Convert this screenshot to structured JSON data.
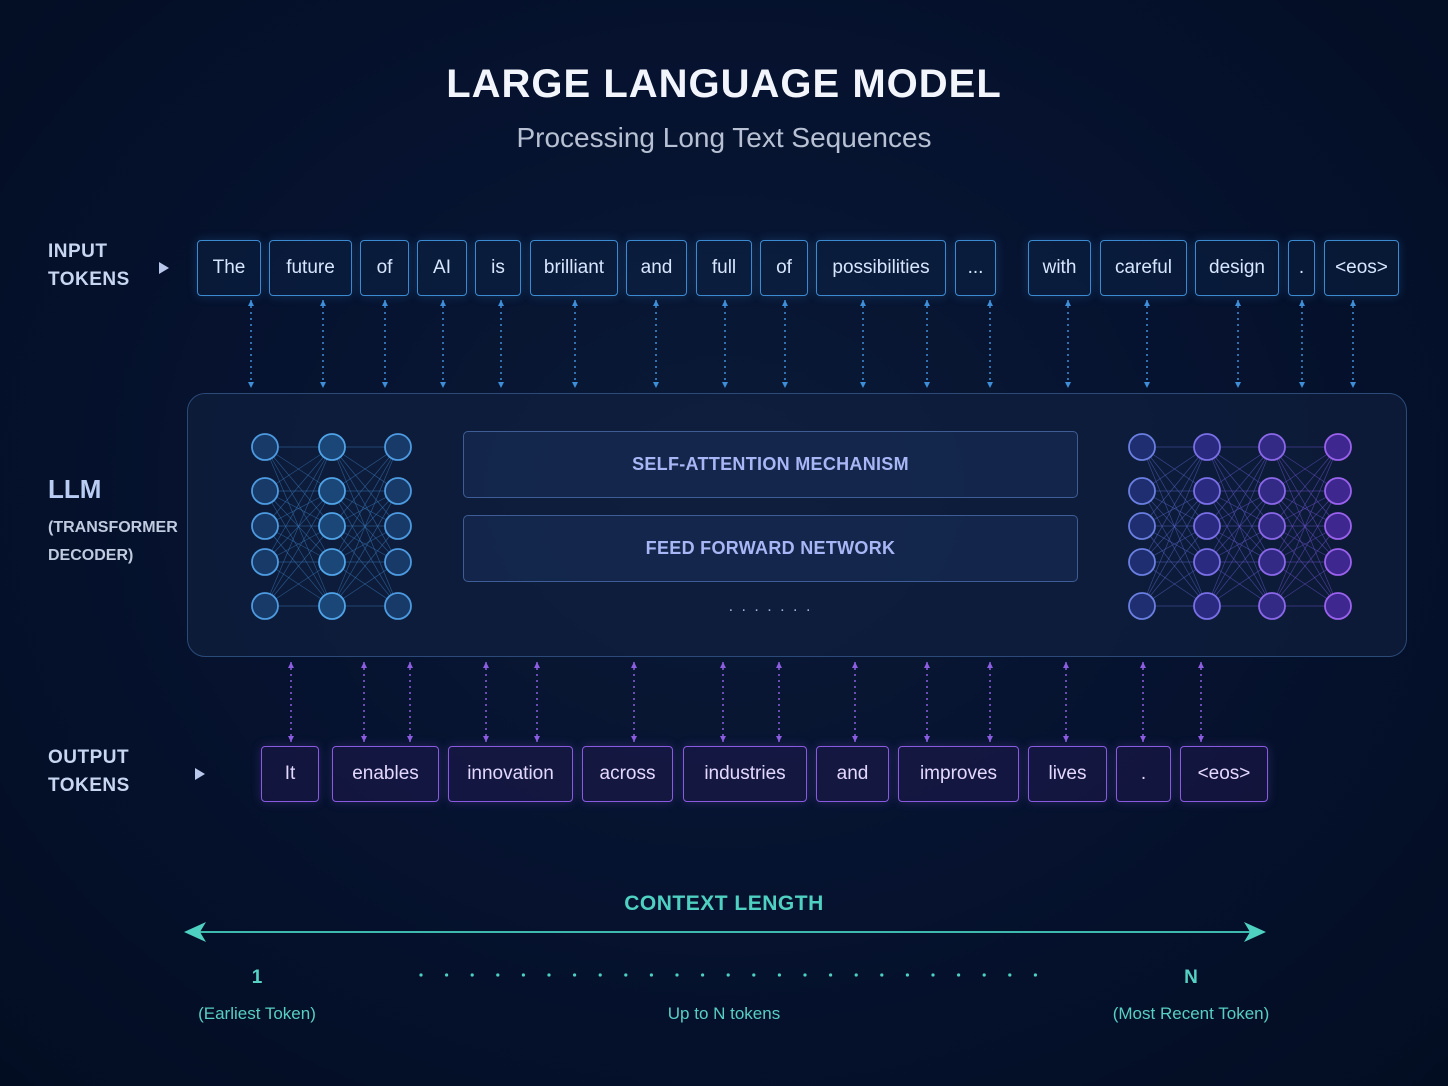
{
  "header": {
    "title": "LARGE LANGUAGE MODEL",
    "subtitle": "Processing Long Text Sequences"
  },
  "input": {
    "label_line1": "INPUT",
    "label_line2": "TOKENS",
    "tokens": [
      "The",
      "future",
      "of",
      "AI",
      "is",
      "brilliant",
      "and",
      "full",
      "of",
      "possibilities",
      "...",
      "with",
      "careful",
      "design",
      ".",
      "<eos>"
    ]
  },
  "llm": {
    "title": "LLM",
    "sub_line1": "(TRANSFORMER",
    "sub_line2": "DECODER)",
    "layers": [
      "SELF-ATTENTION MECHANISM",
      "FEED FORWARD NETWORK"
    ],
    "ellipsis": ". . . . . . ."
  },
  "output": {
    "label_line1": "OUTPUT",
    "label_line2": "TOKENS",
    "tokens": [
      "It",
      "enables",
      "innovation",
      "across",
      "industries",
      "and",
      "improves",
      "lives",
      ".",
      "<eos>"
    ]
  },
  "context": {
    "title": "CONTEXT LENGTH",
    "start_num": "1",
    "start_note": "(Earliest Token)",
    "middle_note": "Up to N tokens",
    "end_num": "N",
    "end_note": "(Most Recent Token)"
  },
  "colors": {
    "input_accent": "#3c8ad0",
    "output_accent": "#8a5ae0",
    "context_accent": "#4fd1c2"
  }
}
